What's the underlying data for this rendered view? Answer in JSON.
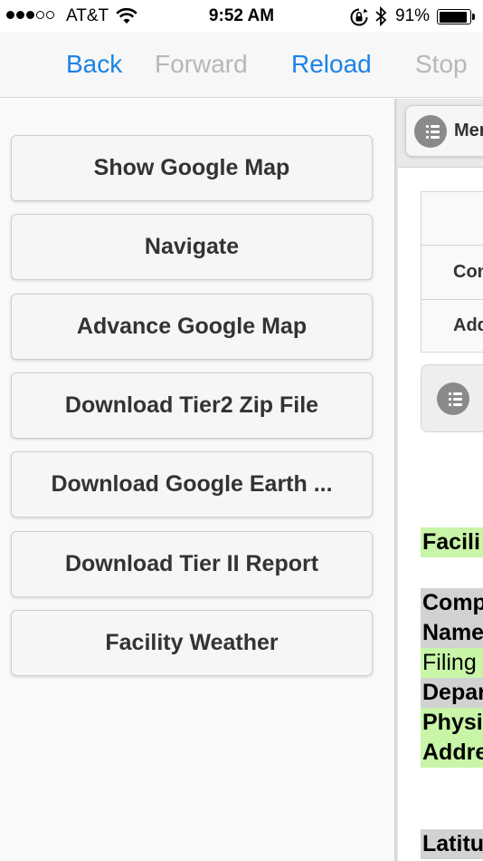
{
  "status_bar": {
    "carrier": "AT&T",
    "time": "9:52 AM",
    "battery": "91%",
    "battery_level": 0.91,
    "icons": [
      "signal-icon",
      "wifi-icon",
      "rotation-lock-icon",
      "bluetooth-icon",
      "battery-icon"
    ]
  },
  "nav": {
    "back": "Back",
    "forward": "Forward",
    "reload": "Reload",
    "stop": "Stop",
    "enabled_color": "#1a83ea",
    "disabled_color": "#b7b7b7"
  },
  "menu_buttons": [
    "Show Google Map",
    "Navigate",
    "Advance Google Map",
    "Download Tier2 Zip File",
    "Download Google Earth ...",
    "Download Tier II Report",
    "Facility Weather"
  ],
  "right_panel": {
    "menu_button_label": "Menu",
    "table_rows": [
      "",
      "Con",
      "Add"
    ],
    "info_lines": [
      "Facili",
      "Comp",
      "Name",
      "Filing",
      "Depar",
      "Physi",
      "Addre",
      "Latitu"
    ],
    "highlight_green": "#c8f5a8",
    "highlight_gray": "#d2d2d2"
  }
}
